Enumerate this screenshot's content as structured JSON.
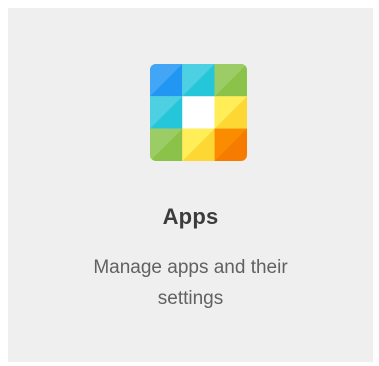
{
  "card": {
    "title": "Apps",
    "description": "Manage apps and their settings",
    "icon": "apps-grid-icon",
    "colors": {
      "background": "#efefef",
      "title": "#3c3c3c",
      "description": "#616161",
      "tile_blue": "#2196f3",
      "tile_cyan": "#26c6da",
      "tile_green": "#8bc34a",
      "tile_yellow": "#fdd835",
      "tile_orange": "#f57c00",
      "tile_center": "#ffffff"
    }
  }
}
